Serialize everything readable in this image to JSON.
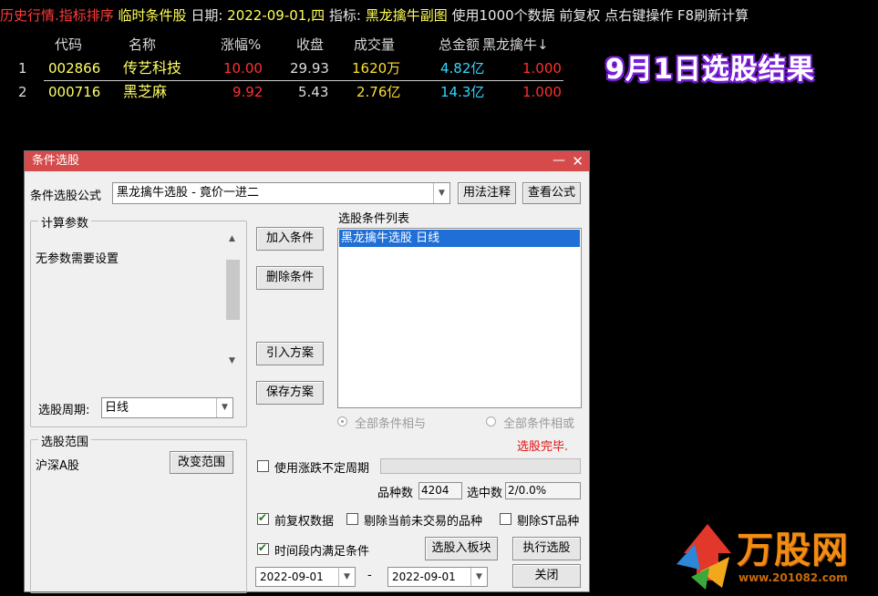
{
  "topbar": {
    "segments": [
      {
        "text": "历史行情.指标排序",
        "color": "#ff3b3b"
      },
      {
        "text": " 临时条件股 ",
        "color": "#ffff55"
      },
      {
        "text": "日期:",
        "color": "#e8e8e8"
      },
      {
        "text": " 2022-09-01,四 ",
        "color": "#ffff55"
      },
      {
        "text": "指标:",
        "color": "#e8e8e8"
      },
      {
        "text": " 黑龙擒牛副图 ",
        "color": "#ffff55"
      },
      {
        "text": "使用1000个数据 前复权 点右键操作 F8刷新计算",
        "color": "#e8e8e8"
      }
    ]
  },
  "stock_table": {
    "headers": {
      "code": "代码",
      "name": "名称",
      "change": "涨幅%",
      "close": "收盘",
      "volume": "成交量",
      "amount": "总金额",
      "indicator": "黑龙擒牛↓"
    },
    "rows": [
      {
        "idx": "1",
        "code": "002866",
        "name": "传艺科技",
        "change": "10.00",
        "close": "29.93",
        "volume": "1620万",
        "amount": "4.82亿",
        "indicator": "1.000"
      },
      {
        "idx": "2",
        "code": "000716",
        "name": "黑芝麻",
        "change": "9.92",
        "close": "5.43",
        "volume": "2.76亿",
        "amount": "14.3亿",
        "indicator": "1.000"
      }
    ]
  },
  "result_title": "9月1日选股结果",
  "dialog": {
    "title": "条件选股",
    "min_icon": "minimize-icon",
    "close_icon": "close-icon",
    "formula_label": "条件选股公式",
    "formula_value": "黑龙擒牛选股 - 竟价一进二",
    "usage_button": "用法注释",
    "view_formula_button": "查看公式",
    "calc_params_label": "计算参数",
    "no_params_text": "无参数需要设置",
    "period_label": "选股周期:",
    "period_value": "日线",
    "scope_label": "选股范围",
    "scope_value": "沪深A股",
    "change_scope_button": "改变范围",
    "add_condition_button": "加入条件",
    "delete_condition_button": "删除条件",
    "import_plan_button": "引入方案",
    "save_plan_button": "保存方案",
    "condition_list_label": "选股条件列表",
    "condition_items": [
      "黑龙擒牛选股  日线"
    ],
    "radio_and_label": "全部条件相与",
    "radio_or_label": "全部条件相或",
    "status_text": "选股完毕.",
    "use_variable_period_label": "使用涨跌不定周期",
    "variety_count_label": "品种数",
    "variety_count_value": "4204",
    "selected_count_label": "选中数",
    "selected_count_value": "2/0.0%",
    "adjust_label": "前复权数据",
    "exclude_untraded_label": "剔除当前未交易的品种",
    "exclude_st_label": "剔除ST品种",
    "period_condition_label": "时间段内满足条件",
    "add_to_block_button": "选股入板块",
    "execute_button": "执行选股",
    "start_date": "2022-09-01",
    "date_separator": "-",
    "end_date": "2022-09-01",
    "close_button": "关闭",
    "checks": {
      "variable_period": false,
      "adjust": true,
      "exclude_untraded": false,
      "exclude_st": false,
      "period_condition": true
    }
  },
  "logo": {
    "text": "万股网",
    "url_text": "www.201082.com"
  },
  "colors": {
    "dialog_titlebar": "#d54a4a",
    "selection": "#1f6fd6",
    "status_red": "#e01010",
    "up_red": "#ff3030",
    "amount_cyan": "#34d6ff"
  }
}
